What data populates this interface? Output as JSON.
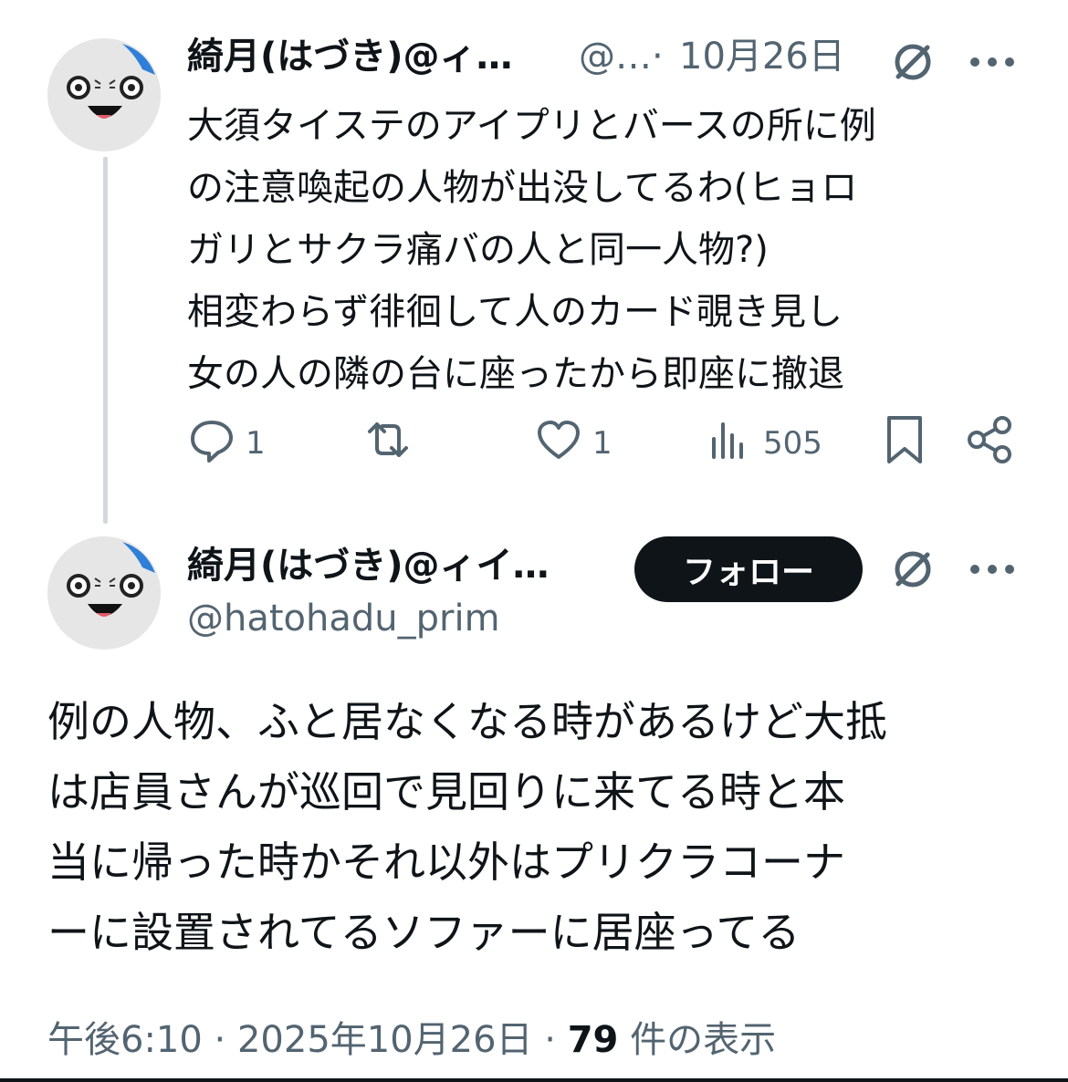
{
  "tweet1": {
    "display_name": "綺月(はづき)@ィ…",
    "handle": "@…",
    "separator": "·",
    "date": "10月26日",
    "text": "大須タイステのアイプリとバースの所に例\nの注意喚起の人物が出没してるわ(ヒョロ\nガリとサクラ痛バの人と同一人物?)\n相変わらず徘徊して人のカード覗き見し\n女の人の隣の台に座ったから即座に撤退",
    "replies": "1",
    "likes": "1",
    "views": "505"
  },
  "tweet2": {
    "display_name": "綺月(はづき)@ィイ…",
    "handle": "@hatohadu_prim",
    "follow_label": "フォロー",
    "text": "例の人物、ふと居なくなる時があるけど大抵\nは店員さんが巡回で見回りに来てる時と本\n当に帰った時かそれ以外はプリクラコーナ\nーに設置されてるソファーに居座ってる",
    "time": "午後6:10 · 2025年10月26日 · ",
    "view_count": "79",
    "view_label": " 件の表示"
  },
  "icons": {
    "grok": "grok-icon",
    "more": "more-icon",
    "reply": "reply-icon",
    "retweet": "retweet-icon",
    "like": "heart-icon",
    "views": "views-icon",
    "bookmark": "bookmark-icon",
    "share": "share-icon"
  },
  "colors": {
    "text": "#0f1419",
    "secondary": "#536471",
    "thread_line": "#cfd9de",
    "follow_bg": "#0f1419"
  }
}
